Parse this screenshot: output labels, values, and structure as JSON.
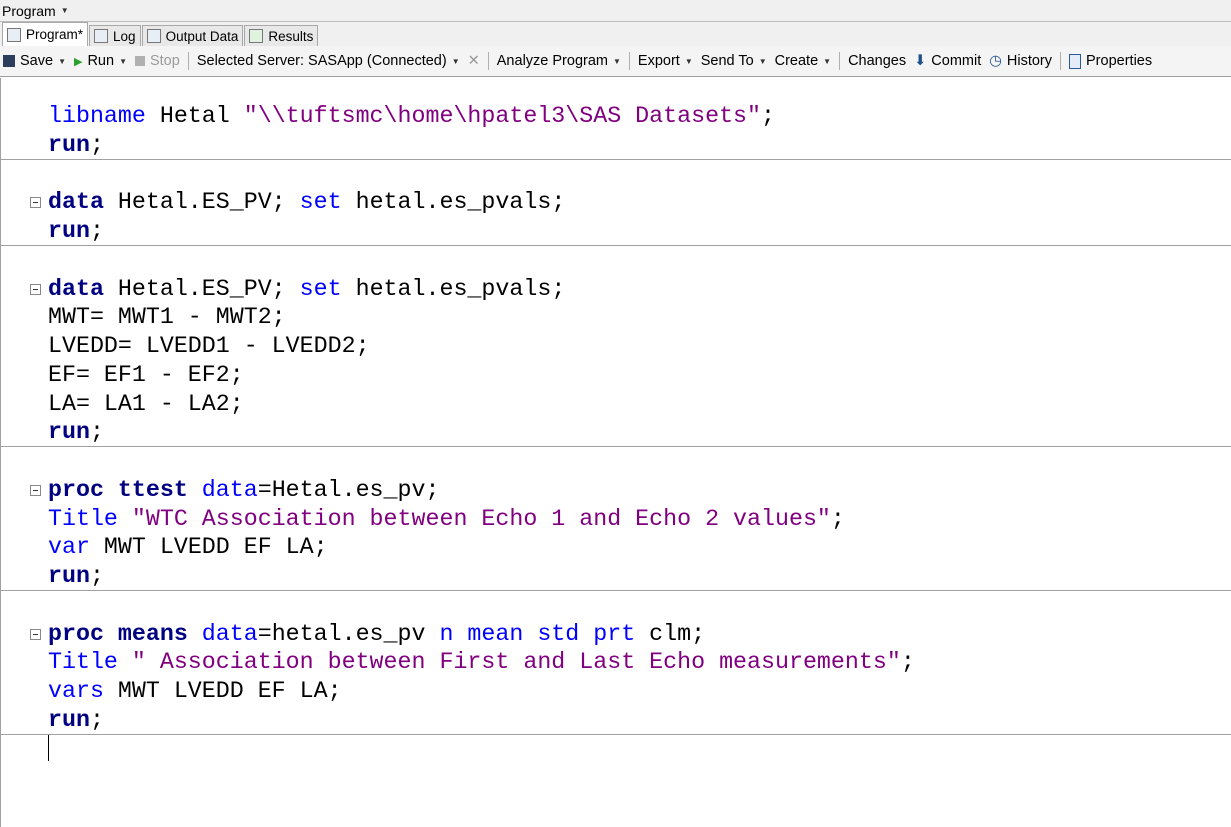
{
  "menu": {
    "program_label": "Program"
  },
  "tabs": [
    {
      "label": "Program*",
      "icon": "program-icon",
      "active": true
    },
    {
      "label": "Log",
      "icon": "log-icon"
    },
    {
      "label": "Output Data",
      "icon": "output-data-icon"
    },
    {
      "label": "Results",
      "icon": "results-icon"
    }
  ],
  "toolbar": {
    "save": "Save",
    "run": "Run",
    "stop": "Stop",
    "server": "Selected Server: SASApp (Connected)",
    "analyze": "Analyze Program",
    "export": "Export",
    "send_to": "Send To",
    "create": "Create",
    "changes": "Changes",
    "commit": "Commit",
    "history": "History",
    "properties": "Properties"
  },
  "code_blocks": [
    {
      "foldable": false,
      "lines": [
        [
          [
            "libname ",
            "bl"
          ],
          [
            "Hetal ",
            "tx"
          ],
          [
            "\"\\\\tuftsmc\\home\\hpatel3\\SAS Datasets\"",
            "st"
          ],
          [
            ";",
            "tx"
          ]
        ],
        [
          [
            "run",
            "kw"
          ],
          [
            ";",
            "tx"
          ]
        ]
      ]
    },
    {
      "foldable": true,
      "lines": [
        [
          [
            "data",
            "kw"
          ],
          [
            " Hetal.ES_PV; ",
            "tx"
          ],
          [
            "set",
            "bl"
          ],
          [
            " hetal.es_pvals;",
            "tx"
          ]
        ],
        [
          [
            "run",
            "kw"
          ],
          [
            ";",
            "tx"
          ]
        ]
      ]
    },
    {
      "foldable": true,
      "lines": [
        [
          [
            "data",
            "kw"
          ],
          [
            " Hetal.ES_PV; ",
            "tx"
          ],
          [
            "set",
            "bl"
          ],
          [
            " hetal.es_pvals;",
            "tx"
          ]
        ],
        [
          [
            "MWT= MWT1 - MWT2;",
            "tx"
          ]
        ],
        [
          [
            "LVEDD= LVEDD1 - LVEDD2;",
            "tx"
          ]
        ],
        [
          [
            "EF= EF1 - EF2;",
            "tx"
          ]
        ],
        [
          [
            "LA= LA1 - LA2;",
            "tx"
          ]
        ],
        [
          [
            "run",
            "kw"
          ],
          [
            ";",
            "tx"
          ]
        ]
      ]
    },
    {
      "foldable": true,
      "lines": [
        [
          [
            "proc ttest",
            "kw"
          ],
          [
            " ",
            "tx"
          ],
          [
            "data",
            "bl"
          ],
          [
            "=Hetal.es_pv;",
            "tx"
          ]
        ],
        [
          [
            "Title ",
            "bl"
          ],
          [
            "\"WTC Association between Echo 1 and Echo 2 values\"",
            "st"
          ],
          [
            ";",
            "tx"
          ]
        ],
        [
          [
            "var",
            "bl"
          ],
          [
            " MWT LVEDD EF LA;",
            "tx"
          ]
        ],
        [
          [
            "run",
            "kw"
          ],
          [
            ";",
            "tx"
          ]
        ]
      ]
    },
    {
      "foldable": true,
      "lines": [
        [
          [
            "proc means",
            "kw"
          ],
          [
            " ",
            "tx"
          ],
          [
            "data",
            "bl"
          ],
          [
            "=hetal.es_pv ",
            "tx"
          ],
          [
            "n mean std prt",
            "bl"
          ],
          [
            " clm;",
            "tx"
          ]
        ],
        [
          [
            "Title ",
            "bl"
          ],
          [
            "\" Association between First and Last Echo measurements\"",
            "st"
          ],
          [
            ";",
            "tx"
          ]
        ],
        [
          [
            "vars",
            "bl"
          ],
          [
            " MWT LVEDD EF LA;",
            "tx"
          ]
        ],
        [
          [
            "run",
            "kw"
          ],
          [
            ";",
            "tx"
          ]
        ]
      ]
    }
  ]
}
